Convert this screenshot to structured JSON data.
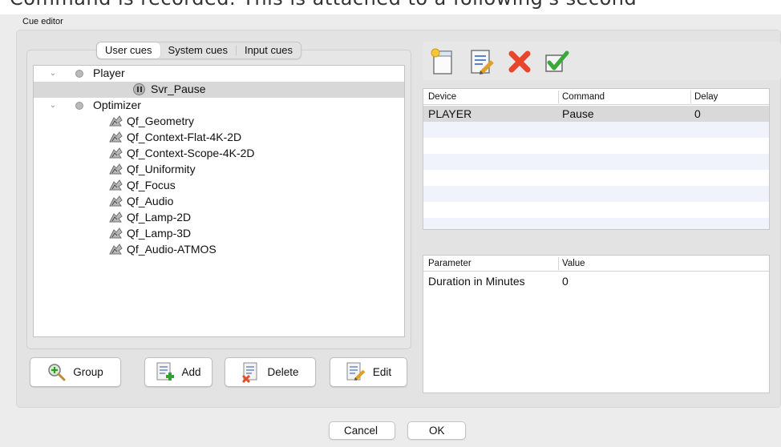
{
  "background_text": "Command is recorded. This is attached to a following's second",
  "window": {
    "title": "Cue editor"
  },
  "tabs": [
    {
      "label": "User cues",
      "active": true
    },
    {
      "label": "System cues",
      "active": false
    },
    {
      "label": "Input cues",
      "active": false
    }
  ],
  "tree": {
    "groups": [
      {
        "label": "Player",
        "expanded": true,
        "icon": "grey-dot-icon",
        "children": [
          {
            "label": "Svr_Pause",
            "icon": "pause-icon",
            "selected": true
          }
        ]
      },
      {
        "label": "Optimizer",
        "expanded": true,
        "icon": "grey-dot-icon",
        "children": [
          {
            "label": "Qf_Geometry",
            "icon": "optimizer-icon"
          },
          {
            "label": "Qf_Context-Flat-4K-2D",
            "icon": "optimizer-icon"
          },
          {
            "label": "Qf_Context-Scope-4K-2D",
            "icon": "optimizer-icon"
          },
          {
            "label": "Qf_Uniformity",
            "icon": "optimizer-icon"
          },
          {
            "label": "Qf_Focus",
            "icon": "optimizer-icon"
          },
          {
            "label": "Qf_Audio",
            "icon": "optimizer-icon"
          },
          {
            "label": "Qf_Lamp-2D",
            "icon": "optimizer-icon"
          },
          {
            "label": "Qf_Lamp-3D",
            "icon": "optimizer-icon"
          },
          {
            "label": "Qf_Audio-ATMOS",
            "icon": "optimizer-icon"
          }
        ]
      }
    ]
  },
  "left_buttons": [
    {
      "label": "Group",
      "icon": "magnifier-plus-icon"
    },
    {
      "label": "Add",
      "icon": "document-add-icon"
    },
    {
      "label": "Delete",
      "icon": "document-delete-icon"
    },
    {
      "label": "Edit",
      "icon": "document-edit-icon"
    }
  ],
  "toolbar": [
    {
      "icon": "new-document-icon"
    },
    {
      "icon": "edit-document-icon"
    },
    {
      "icon": "delete-x-icon"
    },
    {
      "icon": "checkmark-icon"
    }
  ],
  "commands_table": {
    "columns": [
      "Device",
      "Command",
      "Delay"
    ],
    "rows": [
      {
        "device": "PLAYER",
        "command": "Pause",
        "delay": "0"
      }
    ]
  },
  "params_table": {
    "columns": [
      "Parameter",
      "Value"
    ],
    "rows": [
      {
        "parameter": "Duration in Minutes",
        "value": "0"
      }
    ]
  },
  "dialog_buttons": {
    "cancel": "Cancel",
    "ok": "OK"
  },
  "colors": {
    "window_bg": "#ececec",
    "selected_row": "#d8d8d8",
    "stripe": "#f0f3fb",
    "delete_red": "#e8452c",
    "check_green": "#3aa83a"
  }
}
